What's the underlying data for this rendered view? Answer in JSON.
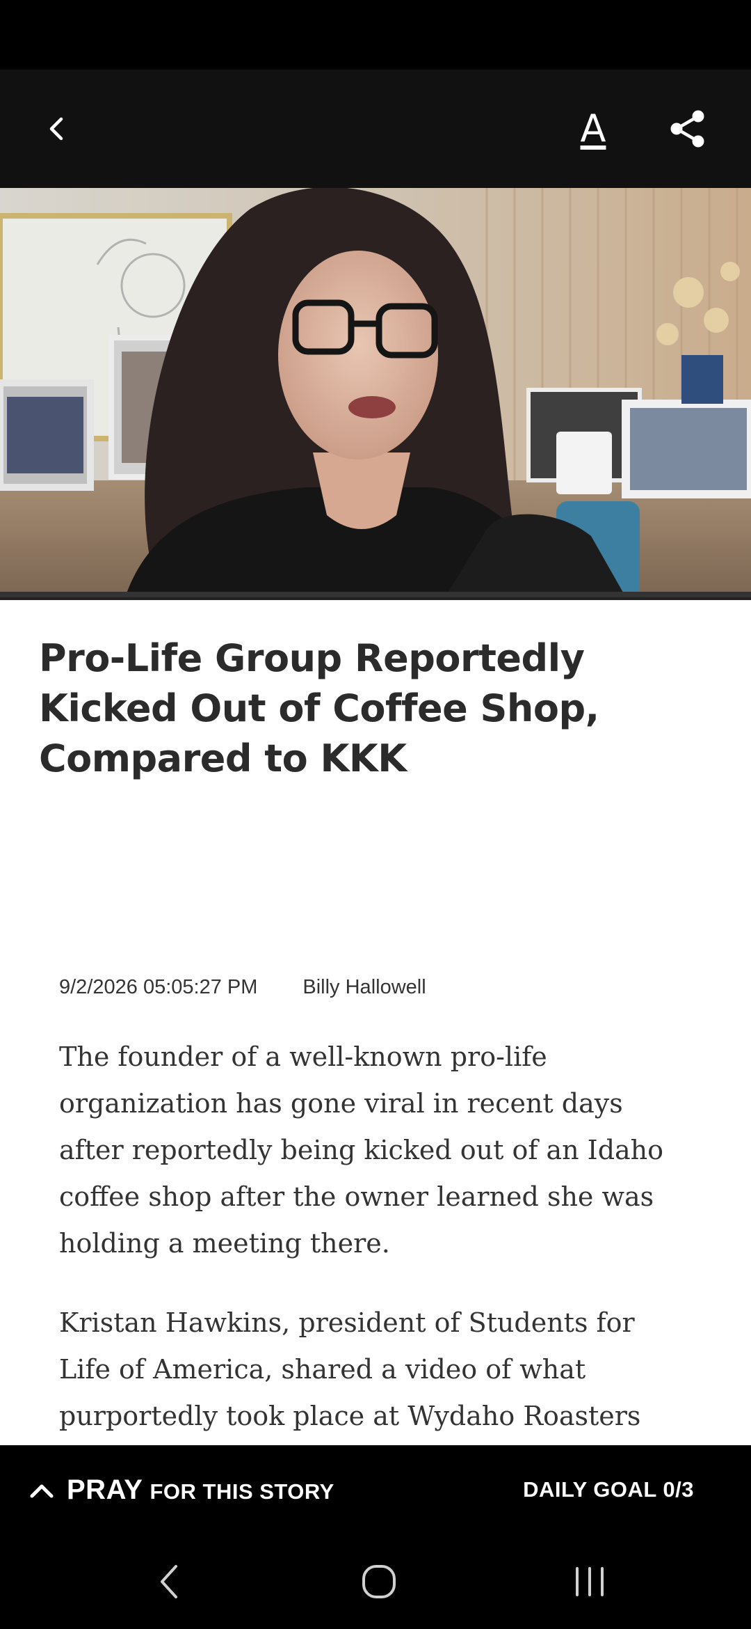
{
  "app_bar": {
    "icons": [
      "back-icon",
      "text-size-icon",
      "share-icon"
    ],
    "text_size_glyph": "A"
  },
  "hero_image": {
    "description_icon": "hero-photo"
  },
  "article": {
    "title": "Pro-Life Group Reportedly Kicked Out of Coffee Shop, Compared to KKK",
    "date": "9/2/2026 05:05:27 PM",
    "author": "Billy Hallowell",
    "paragraphs": [
      "The founder of a well-known pro-life organization has gone viral in recent days after reportedly being kicked out of an Idaho coffee shop after the owner learned she was holding a meeting there.",
      "Kristan Hawkins, president of Students for Life of America, shared a video of what purportedly took place at Wydaho Roasters"
    ]
  },
  "pray_bar": {
    "pray_word": "PRAY",
    "pray_rest": "FOR THIS STORY",
    "daily_goal": "DAILY GOAL 0/3",
    "icon": "chevron-up-icon"
  },
  "system_nav": {
    "icons": [
      "nav-back-icon",
      "nav-home-icon",
      "nav-recents-icon"
    ]
  },
  "colors": {
    "status_bar": "#000000",
    "app_bar": "#111111",
    "title_text": "#2b2b2b",
    "body_text": "#333333",
    "pray_bar": "#000000"
  }
}
